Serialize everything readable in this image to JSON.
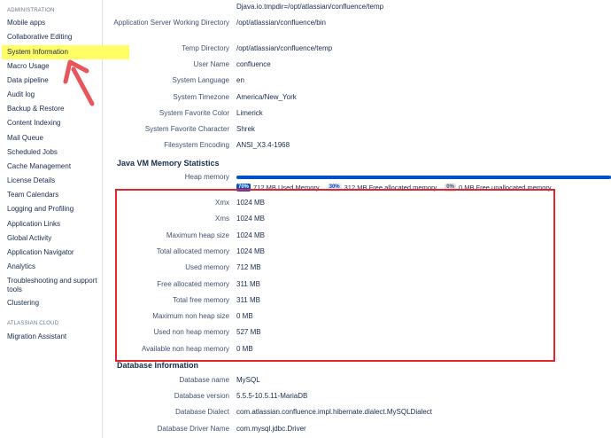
{
  "sidebar": {
    "section_admin": "ADMINISTRATION",
    "section_cloud": "ATLASSIAN CLOUD",
    "items": [
      {
        "label": "Mobile apps"
      },
      {
        "label": "Collaborative Editing"
      },
      {
        "label": "System Information",
        "active": true
      },
      {
        "label": "Macro Usage"
      },
      {
        "label": "Data pipeline"
      },
      {
        "label": "Audit log"
      },
      {
        "label": "Backup & Restore"
      },
      {
        "label": "Content Indexing"
      },
      {
        "label": "Mail Queue"
      },
      {
        "label": "Scheduled Jobs"
      },
      {
        "label": "Cache Management"
      },
      {
        "label": "License Details"
      },
      {
        "label": "Team Calendars"
      },
      {
        "label": "Logging and Profiling"
      },
      {
        "label": "Application Links"
      },
      {
        "label": "Global Activity"
      },
      {
        "label": "Application Navigator"
      },
      {
        "label": "Analytics"
      },
      {
        "label": "Troubleshooting and support tools"
      },
      {
        "label": "Clustering"
      }
    ],
    "cloud_items": [
      {
        "label": "Migration Assistant"
      }
    ]
  },
  "system_info": {
    "top_value": "Djava.io.tmpdir=/opt/atlassian/confluence/temp",
    "rows": [
      {
        "label": "Application Server Working Directory",
        "value": "/opt/atlassian/confluence/bin"
      },
      {
        "label": "Temp Directory",
        "value": "/opt/atlassian/confluence/temp"
      },
      {
        "label": "User Name",
        "value": "confluence"
      },
      {
        "label": "System Language",
        "value": "en"
      },
      {
        "label": "System Timezone",
        "value": "America/New_York"
      },
      {
        "label": "System Favorite Color",
        "value": "Limerick"
      },
      {
        "label": "System Favorite Character",
        "value": "Shrek"
      },
      {
        "label": "Filesystem Encoding",
        "value": "ANSI_X3.4-1968"
      }
    ]
  },
  "jvm": {
    "title": "Java VM Memory Statistics",
    "heap_label": "Heap memory",
    "heap": {
      "used_pct_label": "70%",
      "used_text": "712 MB Used Memory",
      "free_pct_label": "30%",
      "free_text": "312 MB Free allocated memory",
      "unalloc_pct_label": "0%",
      "unalloc_text": "0 MB Free unallocated memory"
    },
    "rows": [
      {
        "label": "Xmx",
        "value": "1024 MB"
      },
      {
        "label": "Xms",
        "value": "1024 MB"
      },
      {
        "label": "Maximum heap size",
        "value": "1024 MB"
      },
      {
        "label": "Total allocated memory",
        "value": "1024 MB"
      },
      {
        "label": "Used memory",
        "value": "712 MB"
      },
      {
        "label": "Free allocated memory",
        "value": "311 MB"
      },
      {
        "label": "Total free memory",
        "value": "311 MB"
      },
      {
        "label": "Maximum non heap size",
        "value": "0 MB"
      },
      {
        "label": "Used non heap memory",
        "value": "527 MB"
      },
      {
        "label": "Available non heap memory",
        "value": "0 MB"
      }
    ]
  },
  "database": {
    "title": "Database Information",
    "rows": [
      {
        "label": "Database name",
        "value": "MySQL"
      },
      {
        "label": "Database version",
        "value": "5.5.5-10.5.11-MariaDB"
      },
      {
        "label": "Database Dialect",
        "value": "com.atlassian.confluence.impl.hibernate.dialect.MySQLDialect"
      },
      {
        "label": "Database Driver Name",
        "value": "com.mysql.jdbc.Driver"
      }
    ]
  },
  "colors": {
    "highlight_yellow": "#fffe66",
    "annotation_red": "#e3262d",
    "heap_bar_blue": "#0052cc"
  }
}
